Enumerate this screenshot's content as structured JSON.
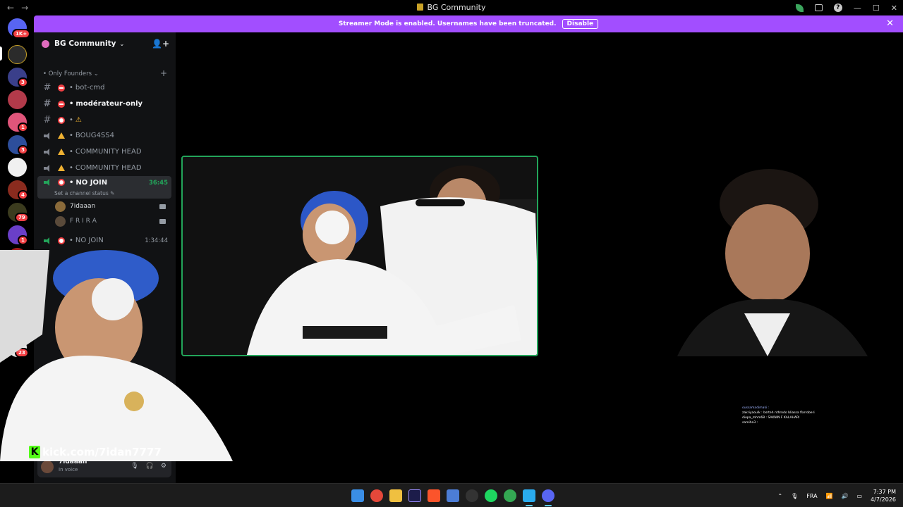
{
  "window": {
    "title": "BG Community",
    "back_icon": "←",
    "forward_icon": "→",
    "minimize": "—",
    "maximize": "☐",
    "close": "✕"
  },
  "banner": {
    "message": "Streamer Mode is enabled. Usernames have been truncated.",
    "button": "Disable",
    "close": "✕",
    "color": "#a24eff"
  },
  "server_rail": {
    "badges": [
      "1K+",
      "3",
      "1",
      "3",
      "4",
      "79",
      "1",
      "23"
    ]
  },
  "guild": {
    "name": "BG Community",
    "chevron": "⌄",
    "invite_icon": "👤+"
  },
  "category": {
    "name": "Only Founders",
    "collapse": "⌄",
    "add": "+"
  },
  "channels": [
    {
      "name": "bot-cmd",
      "prefix": "•"
    },
    {
      "name": "modérateur-only",
      "prefix": "•"
    },
    {
      "name": "⚠",
      "prefix": "•"
    },
    {
      "name": "BOUG4SS4",
      "prefix": "•"
    },
    {
      "name": "COMMUNITY HEAD",
      "prefix": "•"
    },
    {
      "name": "COMMUNITY HEAD",
      "prefix": "•"
    },
    {
      "name": "NO JOIN",
      "prefix": "•",
      "time": "36:45",
      "status": "Set a channel status"
    },
    {
      "name": "NO JOIN",
      "prefix": "•",
      "time": "1:34:44"
    }
  ],
  "voice_users": [
    {
      "name": "7idaaan"
    },
    {
      "name": "F R I R A"
    }
  ],
  "voice_panel": {
    "name": "7idaaan",
    "status": "In voice",
    "mic": "🎙",
    "headset": "🎧",
    "settings": "⚙"
  },
  "stream_overlay": {
    "kick_logo": "K",
    "kick_url": "kick.com/7idan7777"
  },
  "chat_overlay": [
    "oussamadimaki : ",
    "zakriyaoulk : bsrteh nthrndo bliassa flarroberi",
    "diopa_mhm68 : SAKNIN F KALAHARI",
    "samiha3 : "
  ],
  "taskbar": {
    "language": "FRA",
    "time": "7:37 PM",
    "date": "4/7/2026",
    "tray_chevron": "⌃"
  },
  "colors": {
    "accent": "#a24eff",
    "speaking": "#23a55a",
    "danger": "#f23f43",
    "warning": "#f0b232"
  }
}
